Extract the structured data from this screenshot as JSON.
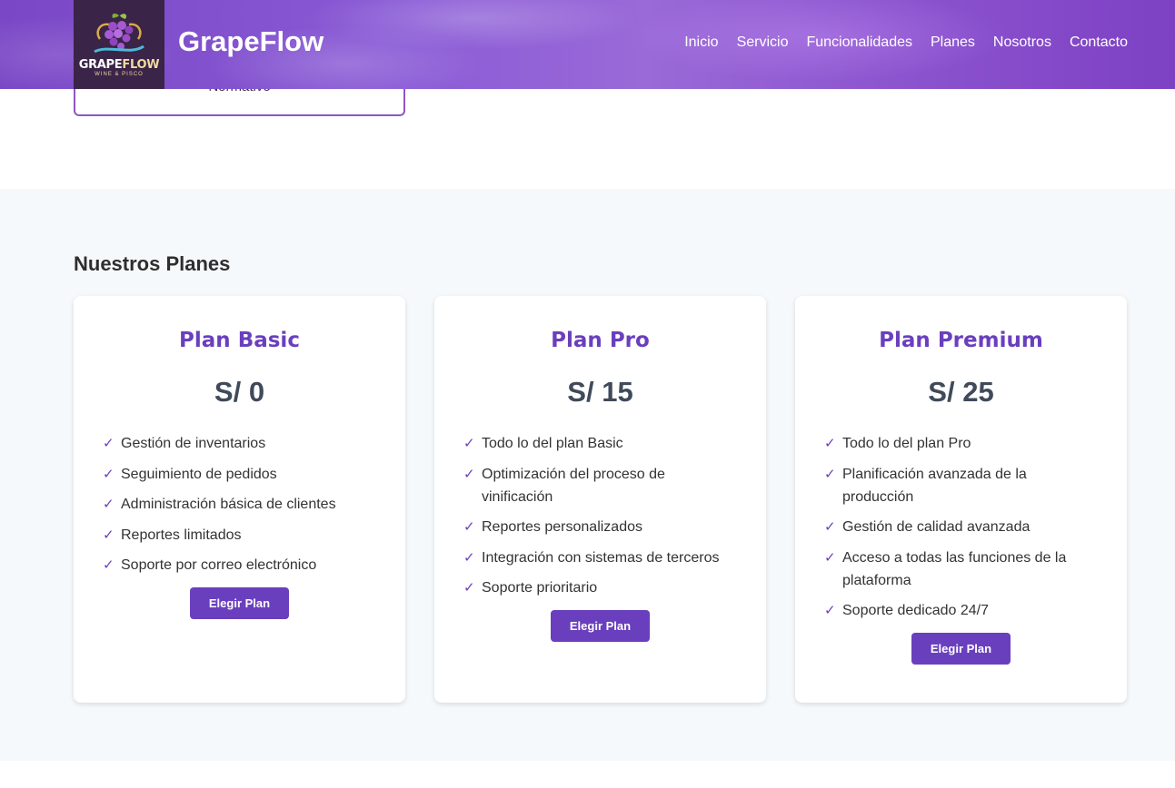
{
  "header": {
    "logo_word_main": "GRAPE",
    "logo_word_accent": "FLOW",
    "logo_sub": "WINE & PISCO",
    "brand": "GrapeFlow",
    "nav": [
      "Inicio",
      "Servicio",
      "Funcionalidades",
      "Planes",
      "Nosotros",
      "Contacto"
    ]
  },
  "prev_card": {
    "text": "Normativo"
  },
  "plans": {
    "title": "Nuestros Planes",
    "cards": [
      {
        "title": "Plan Basic",
        "price": "S/ 0",
        "features": [
          "Gestión de inventarios",
          "Seguimiento de pedidos",
          "Administración básica de clientes",
          "Reportes limitados",
          "Soporte por correo electrónico"
        ],
        "button": "Elegir Plan"
      },
      {
        "title": "Plan Pro",
        "price": "S/ 15",
        "features": [
          "Todo lo del plan Basic",
          "Optimización del proceso de vinificación",
          "Reportes personalizados",
          "Integración con sistemas de terceros",
          "Soporte prioritario"
        ],
        "button": "Elegir Plan"
      },
      {
        "title": "Plan Premium",
        "price": "S/ 25",
        "features": [
          "Todo lo del plan Pro",
          "Planificación avanzada de la producción",
          "Gestión de calidad avanzada",
          "Acceso a todas las funciones de la plataforma",
          "Soporte dedicado 24/7"
        ],
        "button": "Elegir Plan"
      }
    ],
    "check_glyph": "✓"
  },
  "colors": {
    "accent": "#6a3fbe",
    "header": "#8a5bd6",
    "section_bg": "#f6f9fb"
  }
}
